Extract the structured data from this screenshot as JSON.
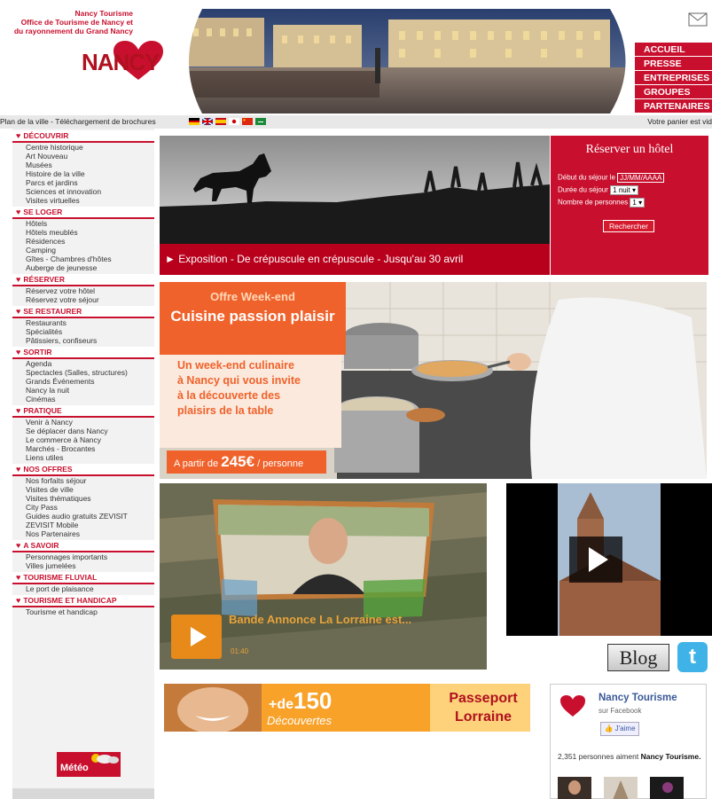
{
  "header": {
    "org_line1": "Nancy Tourisme",
    "org_line2": "Office de Tourisme de Nancy et",
    "org_line3": "du rayonnement du Grand Nancy",
    "logo_text": "NANCY",
    "logo_icon": "heart-icon",
    "mail_icon": "envelope-icon",
    "nav": [
      "ACCUEIL",
      "PRESSE",
      "ENTREPRISES",
      "GROUPES",
      "PARTENAIRES"
    ]
  },
  "strip": {
    "left_text": "Plan de la ville - Téléchargement de brochures",
    "cart_text": "Votre panier est vid",
    "flags": [
      "german-flag-icon",
      "british-flag-icon",
      "spanish-flag-icon",
      "japanese-flag-icon",
      "chinese-flag-icon",
      "arabic-flag-icon"
    ]
  },
  "sidebar": {
    "sections": [
      {
        "title": "DÉCOUVRIR",
        "items": [
          "Centre historique",
          "Art Nouveau",
          "Musées",
          "Histoire de la ville",
          "Parcs et jardins",
          "Sciences et innovation",
          "Visites virtuelles"
        ]
      },
      {
        "title": "SE LOGER",
        "items": [
          "Hôtels",
          "Hôtels meublés",
          "Résidences",
          "Camping",
          "Gîtes - Chambres d'hôtes",
          "Auberge de jeunesse"
        ]
      },
      {
        "title": "RÉSERVER",
        "items": [
          "Réservez votre hôtel",
          "Réservez votre séjour"
        ]
      },
      {
        "title": "SE RESTAURER",
        "items": [
          "Restaurants",
          "Spécialités",
          "Pâtissiers, confiseurs"
        ]
      },
      {
        "title": "SORTIR",
        "items": [
          "Agenda",
          "Spectacles (Salles, structures)",
          "Grands Événements",
          "Nancy la nuit",
          "Cinémas"
        ]
      },
      {
        "title": "PRATIQUE",
        "items": [
          "Venir à Nancy",
          "Se déplacer dans Nancy",
          "Le commerce à Nancy",
          "Marchés - Brocantes",
          "Liens utiles"
        ]
      },
      {
        "title": "NOS OFFRES",
        "items": [
          "Nos forfaits séjour",
          "Visites de ville",
          "Visites thématiques",
          "City Pass",
          "Guides audio gratuits ZEVISIT",
          "ZEVISIT Mobile",
          "Nos Partenaires"
        ]
      },
      {
        "title": "A SAVOIR",
        "items": [
          "Personnages importants",
          "Villes jumelées"
        ]
      },
      {
        "title": "TOURISME FLUVIAL",
        "items": [
          "Le port de plaisance"
        ]
      },
      {
        "title": "TOURISME ET HANDICAP",
        "items": [
          "Tourisme et handicap"
        ]
      }
    ],
    "meteo_label": "Météo"
  },
  "event": {
    "caption": "► Exposition - De crépuscule en crépuscule - Jusqu'au 30 avril"
  },
  "hotel": {
    "title": "Réserver un hôtel",
    "start_label": "Début du séjour le",
    "start_value": "JJ/MM/AAAA",
    "duration_label": "Durée du séjour",
    "duration_value": "1 nuit",
    "persons_label": "Nombre de personnes",
    "persons_value": "1",
    "search_button": "Rechercher"
  },
  "offer": {
    "tag": "Offre Week-end",
    "title": "Cuisine passion plaisir",
    "line1": "Un week-end culinaire",
    "line2": "à Nancy qui vous invite",
    "line3": "à la découverte des",
    "line4": "plaisirs de la table",
    "price_prefix": "A partir de",
    "price": "245€",
    "price_suffix": "/ personne"
  },
  "video1": {
    "title": "Bande Annonce La Lorraine est...",
    "time": "01:40"
  },
  "blog_label": "Blog",
  "twitter_label": "t",
  "passeport": {
    "plus": "+de",
    "number": "150",
    "word": "Découvertes",
    "title_line1": "Passeport",
    "title_line2": "Lorraine"
  },
  "facebook": {
    "name": "Nancy Tourisme",
    "sub": "sur Facebook",
    "like": "J'aime",
    "count_text": "2,351 personnes aiment",
    "count_name": "Nancy Tourisme."
  },
  "colors": {
    "brand_red": "#c8102e",
    "offer_orange": "#f0622b",
    "facebook_blue": "#3b5998"
  }
}
